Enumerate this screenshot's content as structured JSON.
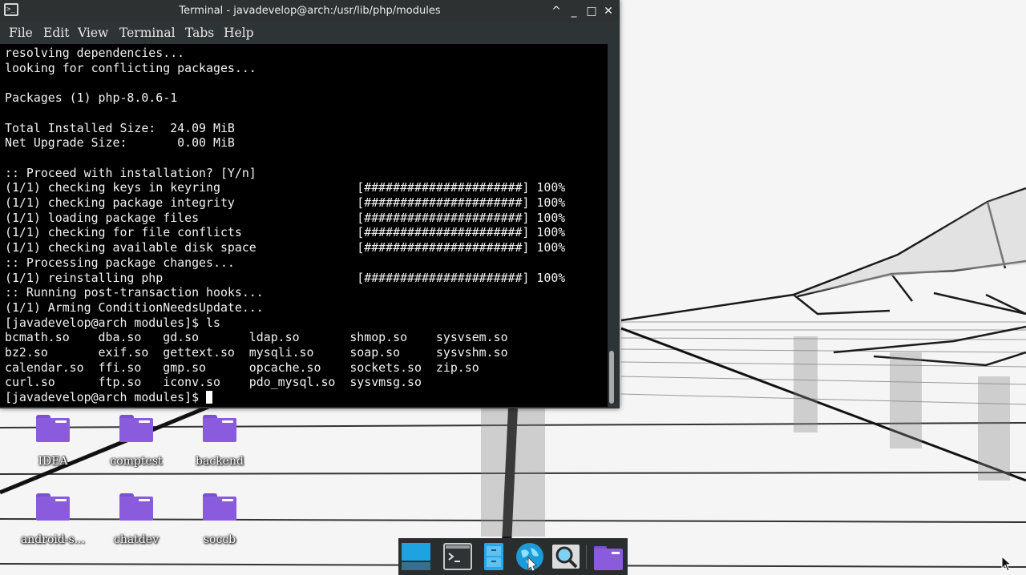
{
  "window": {
    "title": "Terminal - javadevelop@arch:/usr/lib/php/modules",
    "app_icon_glyph": ">_",
    "controls": {
      "maximize_up": "^",
      "minimize": "_",
      "maximize": "□",
      "close": "✕"
    }
  },
  "menu": {
    "file": "File",
    "edit": "Edit",
    "view": "View",
    "terminal": "Terminal",
    "tabs": "Tabs",
    "help": "Help"
  },
  "terminal": {
    "lines": [
      "resolving dependencies...",
      "looking for conflicting packages...",
      "",
      "Packages (1) php-8.0.6-1",
      "",
      "Total Installed Size:  24.09 MiB",
      "Net Upgrade Size:       0.00 MiB",
      "",
      ":: Proceed with installation? [Y/n]",
      "(1/1) checking keys in keyring                   [######################] 100%",
      "(1/1) checking package integrity                 [######################] 100%",
      "(1/1) loading package files                      [######################] 100%",
      "(1/1) checking for file conflicts                [######################] 100%",
      "(1/1) checking available disk space              [######################] 100%",
      ":: Processing package changes...",
      "(1/1) reinstalling php                           [######################] 100%",
      ":: Running post-transaction hooks...",
      "(1/1) Arming ConditionNeedsUpdate...",
      "[javadevelop@arch modules]$ ls",
      "bcmath.so    dba.so   gd.so       ldap.so       shmop.so    sysvsem.so",
      "bz2.so       exif.so  gettext.so  mysqli.so     soap.so     sysvshm.so",
      "calendar.so  ffi.so   gmp.so      opcache.so    sockets.so  zip.so",
      "curl.so      ftp.so   iconv.so    pdo_mysql.so  sysvmsg.so"
    ],
    "prompt": "[javadevelop@arch modules]$ "
  },
  "desktop": {
    "icons": [
      {
        "label": "IDEA"
      },
      {
        "label": "comptest"
      },
      {
        "label": "backend"
      },
      {
        "label": "android-s..."
      },
      {
        "label": "chatdev"
      },
      {
        "label": "soccb"
      }
    ]
  },
  "dock": {
    "items": [
      {
        "name": "show-desktop"
      },
      {
        "name": "terminal"
      },
      {
        "name": "file-manager"
      },
      {
        "name": "web-browser"
      },
      {
        "name": "app-finder"
      },
      {
        "name": "home-folder"
      }
    ]
  },
  "colors": {
    "folder": "#8a5cdd",
    "terminal_bg": "#000000",
    "terminal_fg": "#f2f2f2",
    "chrome": "#2e3436",
    "dock_bg": "#2a2d2e"
  }
}
